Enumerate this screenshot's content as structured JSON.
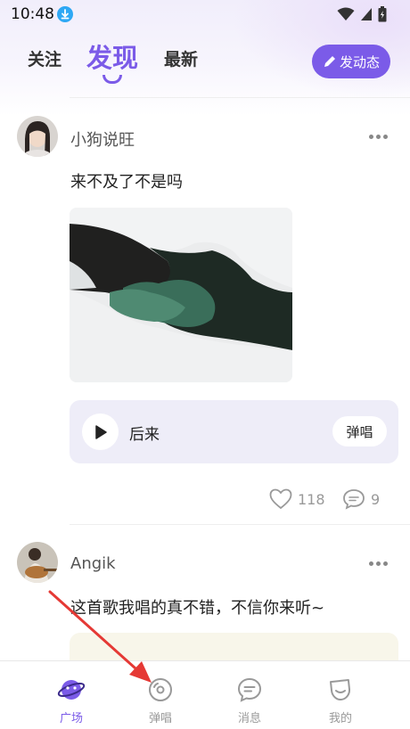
{
  "status_bar": {
    "time": "10:48"
  },
  "top_tabs": {
    "follow": "关注",
    "discover": "发现",
    "latest": "最新",
    "post_button": "发动态"
  },
  "posts": [
    {
      "username": "小狗说旺",
      "text": "来不及了不是吗",
      "song": {
        "title": "后来",
        "sing_label": "弹唱"
      },
      "likes": "118",
      "comments": "9"
    },
    {
      "username": "Angik",
      "text": "这首歌我唱的真不错，不信你来听~"
    }
  ],
  "bottom_nav": {
    "items": [
      {
        "label": "广场",
        "icon": "planet-icon",
        "active": true
      },
      {
        "label": "弹唱",
        "icon": "disc-icon",
        "active": false
      },
      {
        "label": "消息",
        "icon": "message-icon",
        "active": false
      },
      {
        "label": "我的",
        "icon": "profile-icon",
        "active": false
      }
    ]
  },
  "colors": {
    "accent": "#7b5be8",
    "song_card_bg": "#eeedf8",
    "annotation_arrow": "#e53935"
  }
}
